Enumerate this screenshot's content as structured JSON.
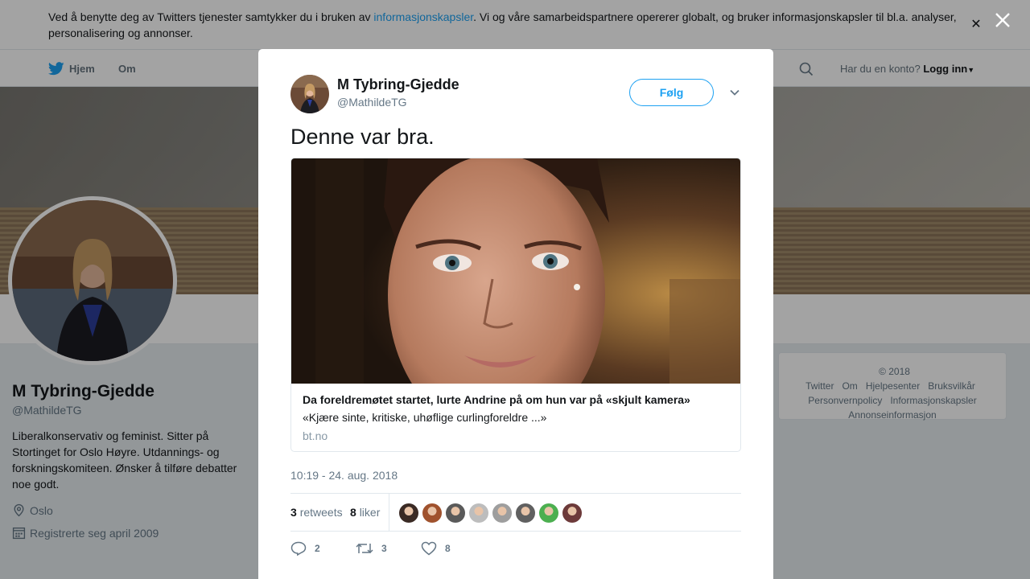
{
  "cookie_banner": {
    "text_before": "Ved å benytte deg av Twitters tjenester samtykker du i bruken av ",
    "link": "informasjonskapsler",
    "text_after": ". Vi og våre samarbeidspartnere opererer globalt, og bruker informasjonskapsler til bl.a. analyser, personalisering og annonser.",
    "close_icon": "close-icon"
  },
  "nav": {
    "home": "Hjem",
    "about": "Om",
    "account_prompt": "Har du en konto?",
    "login": "Logg inn"
  },
  "profile": {
    "name": "M Tybring-Gjedde",
    "handle": "@MathildeTG",
    "bio": "Liberalkonservativ og feminist. Sitter på Stortinget for Oslo Høyre. Utdannings- og forskningskomiteen. Ønsker å tilføre debatter noe godt.",
    "location": "Oslo",
    "joined": "Registrerte seg april 2009"
  },
  "footer": {
    "links": [
      "© 2018 Twitter",
      "Om",
      "Hjelpesenter",
      "Bruksvilkår",
      "Personvernpolicy",
      "Informasjonskapsler",
      "Annonseinformasjon"
    ]
  },
  "tweet": {
    "name": "M Tybring-Gjedde",
    "handle": "@MathildeTG",
    "follow_label": "Følg",
    "text": "Denne var bra.",
    "card": {
      "title": "Da foreldremøtet startet, lurte Andrine på om hun var på «skjult kamera»",
      "description": "«Kjære sinte, kritiske, uhøflige curlingforeldre ...»",
      "domain": "bt.no"
    },
    "timestamp": "10:19 - 24. aug. 2018",
    "retweets_count": "3",
    "retweets_label": "retweets",
    "likes_count": "8",
    "likes_label": "liker",
    "liker_colors": [
      "#3a2a24",
      "#a0522d",
      "#5a5a5a",
      "#bdbdbd",
      "#9e9e9e",
      "#606060",
      "#4caf50",
      "#6d3a3a"
    ],
    "actions": {
      "replies": "2",
      "retweets": "3",
      "likes": "8"
    }
  },
  "colors": {
    "accent": "#1da1f2",
    "text": "#14171a",
    "muted": "#657786"
  }
}
